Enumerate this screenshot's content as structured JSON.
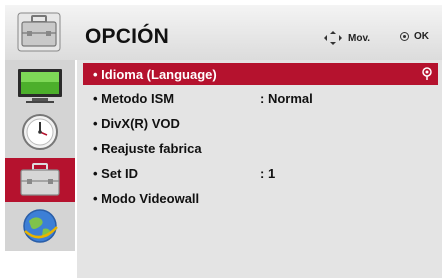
{
  "header": {
    "title": "OPCIÓN",
    "mov_label": "Mov.",
    "ok_label": "OK"
  },
  "sidebar": {
    "items": [
      {
        "icon": "picture-monitor-icon"
      },
      {
        "icon": "clock-icon"
      },
      {
        "icon": "option-briefcase-icon",
        "active": true
      },
      {
        "icon": "network-globe-icon"
      }
    ]
  },
  "menu": {
    "items": [
      {
        "label": "• Idioma (Language)",
        "value": "",
        "selected": true
      },
      {
        "label": "• Metodo ISM",
        "value": ": Normal"
      },
      {
        "label": "• DivX(R) VOD",
        "value": ""
      },
      {
        "label": "• Reajuste fabrica",
        "value": ""
      },
      {
        "label": "• Set ID",
        "value": ": 1"
      },
      {
        "label": "• Modo Videowall",
        "value": ""
      }
    ]
  },
  "colors": {
    "accent": "#b5122e",
    "sidebar_bg": "#d4d4d4",
    "content_bg": "#e4e4e4"
  }
}
